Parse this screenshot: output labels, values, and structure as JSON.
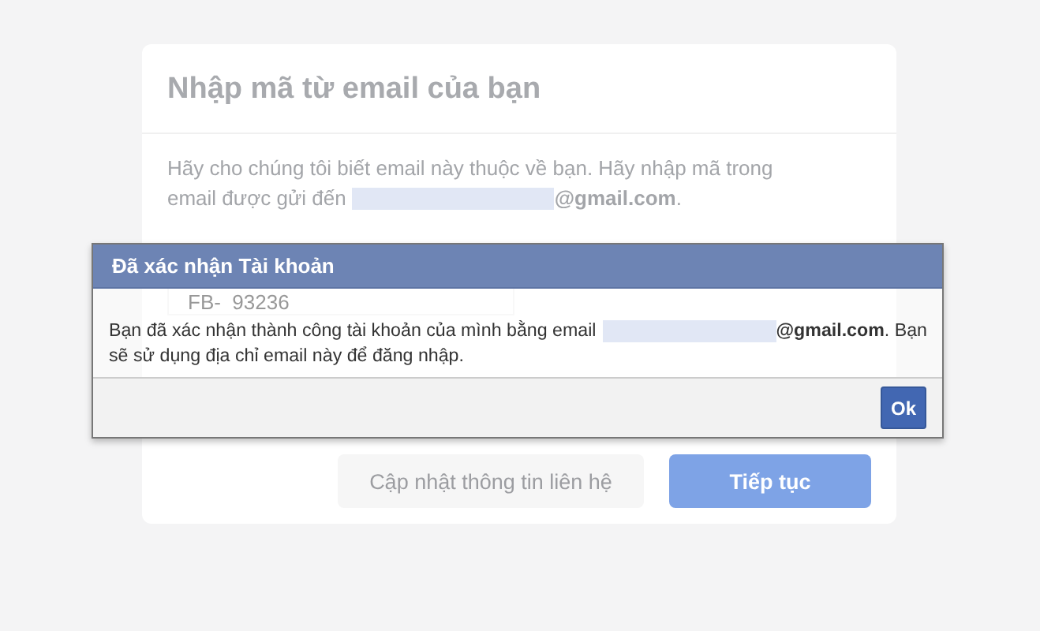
{
  "card": {
    "title": "Nhập mã từ email của bạn",
    "description_line1": "Hãy cho chúng tôi biết email này thuộc về bạn. Hãy nhập mã trong",
    "description_line2_before": "email được gửi đến",
    "description_line2_after": "**@gmail.com**.",
    "code_field": {
      "value": "FB-  93236"
    },
    "buttons": [
      {
        "label": "Cập nhật thông tin liên hệ",
        "kind": "secondary"
      },
      {
        "label": "Tiếp tục",
        "kind": "primary"
      }
    ]
  },
  "dialog": {
    "title": "Đã xác nhận Tài khoản",
    "message_line1_before": "Bạn đã xác nhận thành công tài khoản của mình bằng email",
    "message_line1_after": "**@gmail.com**. Bạn",
    "message_line2": "sẽ sử dụng địa chỉ email này để đăng nhập.",
    "button": "Ok"
  }
}
